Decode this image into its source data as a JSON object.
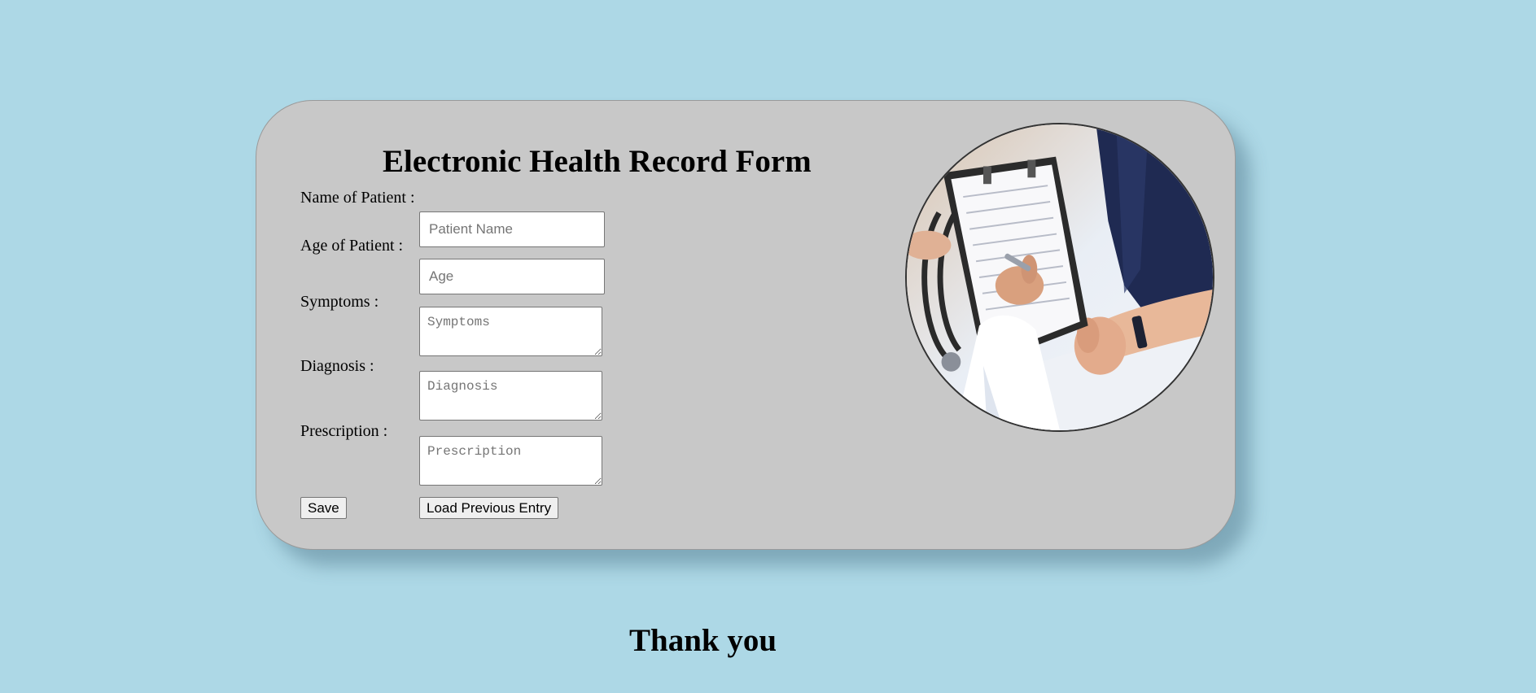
{
  "form": {
    "title": "Electronic Health Record Form",
    "fields": {
      "name": {
        "label": "Name of Patient :",
        "placeholder": "Patient Name",
        "value": ""
      },
      "age": {
        "label": "Age of Patient :",
        "placeholder": "Age",
        "value": ""
      },
      "symptoms": {
        "label": "Symptoms :",
        "placeholder": "Symptoms",
        "value": ""
      },
      "diagnosis": {
        "label": "Diagnosis :",
        "placeholder": "Diagnosis",
        "value": ""
      },
      "prescription": {
        "label": "Prescription :",
        "placeholder": "Prescription",
        "value": ""
      }
    },
    "buttons": {
      "save": "Save",
      "load": "Load Previous Entry"
    }
  },
  "footer": {
    "thanks": "Thank you"
  },
  "colors": {
    "page_background": "#add8e6",
    "card_background": "#c8c8c8"
  }
}
